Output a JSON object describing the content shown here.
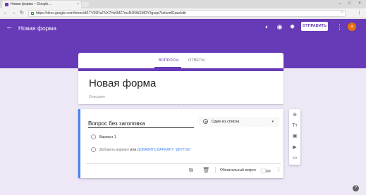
{
  "browser": {
    "tab_title": "Новая форма – Google...",
    "tab_close": "×",
    "url": "https://docs.google.com/forms/d/1TV99RuFNX7Hx6MZ7mzN3NWEMDY3gsqe7kxkcmfGaw/edit",
    "win_min": "–",
    "win_max": "□",
    "win_close": "×",
    "back": "←",
    "forward": "→",
    "reload": "↻",
    "star": "☆",
    "menu": "⋮"
  },
  "header": {
    "back": "←",
    "title": "Новая форма",
    "palette_icon": "◐",
    "preview_icon": "◉",
    "settings_icon": "✹",
    "send_label": "ОТПРАВИТЬ",
    "more": "⋮",
    "avatar_letter": "a",
    "accent": "#673ab7"
  },
  "tabs": {
    "questions": "ВОПРОСЫ",
    "answers": "ОТВЕТЫ"
  },
  "form": {
    "title": "Новая форма",
    "description_placeholder": "Описание"
  },
  "question": {
    "drag": "⋮⋮",
    "title": "Вопрос без заголовка",
    "type": "Один из списка",
    "caret": "▾",
    "option1": "Вариант 1",
    "add_option": "Добавить вариант",
    "or": "или",
    "add_other": "ДОБАВИТЬ ВАРИАНТ \"ДРУГОЕ\"",
    "required_label": "Обязательный вопрос",
    "copy_icon": "⧉",
    "delete_icon": "🗑",
    "more": "⋮"
  },
  "side_toolbar": {
    "add_question": "⊕",
    "add_title": "Tт",
    "add_image": "▣",
    "add_video": "▶",
    "add_section": "▭"
  },
  "help": "?"
}
